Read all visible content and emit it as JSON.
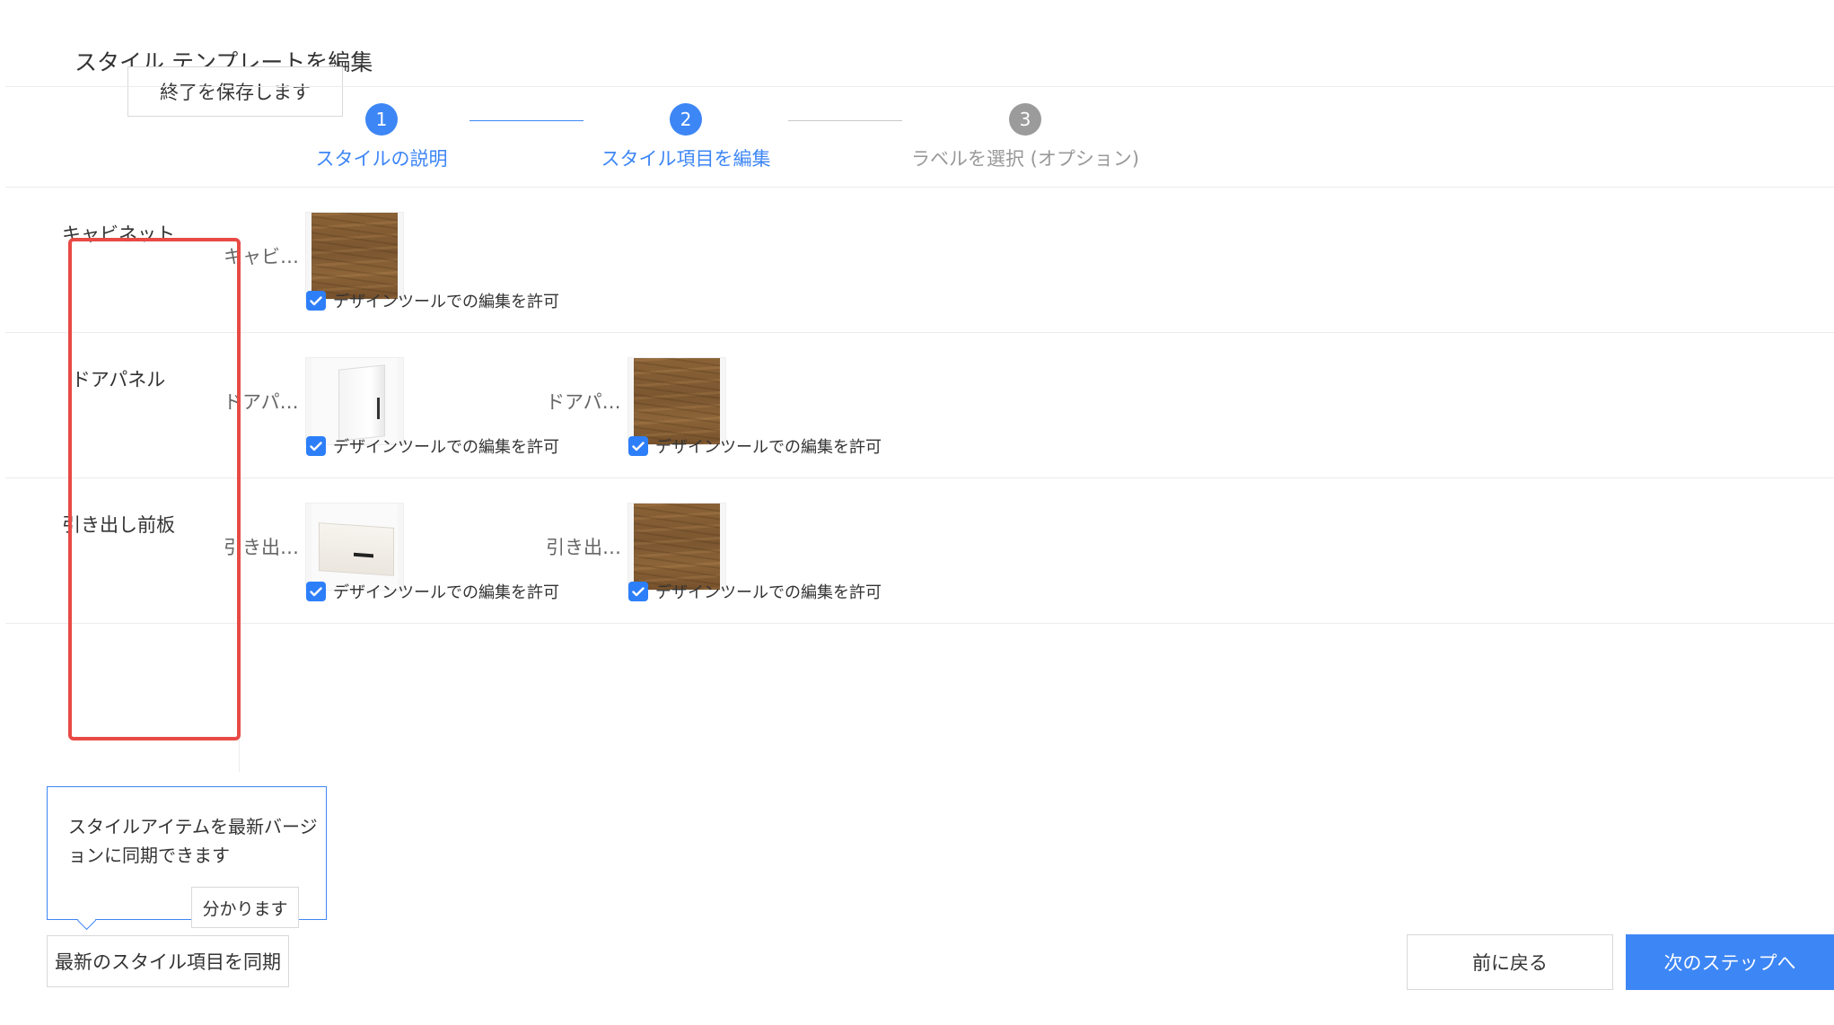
{
  "header": {
    "title": "スタイル テンプレートを編集",
    "save_exit_label": "終了を保存します"
  },
  "steps": [
    {
      "number": "1",
      "label": "スタイルの説明",
      "state": "active"
    },
    {
      "number": "2",
      "label": "スタイル項目を編集",
      "state": "active"
    },
    {
      "number": "3",
      "label": "ラベルを選択 (オプション)",
      "state": "inactive"
    }
  ],
  "rows": [
    {
      "label": "キャビネット",
      "items": [
        {
          "name": "キャビ…",
          "swatch": "wood",
          "allow_edit": "デザインツールでの編集を許可",
          "checked": true
        }
      ]
    },
    {
      "label": "ドアパネル",
      "items": [
        {
          "name": "ドアパ…",
          "swatch": "door",
          "allow_edit": "デザインツールでの編集を許可",
          "checked": true
        },
        {
          "name": "ドアパ…",
          "swatch": "wood",
          "allow_edit": "デザインツールでの編集を許可",
          "checked": true
        }
      ]
    },
    {
      "label": "引き出し前板",
      "items": [
        {
          "name": "引き出…",
          "swatch": "drawer",
          "allow_edit": "デザインツールでの編集を許可",
          "checked": true
        },
        {
          "name": "引き出…",
          "swatch": "wood",
          "allow_edit": "デザインツールでの編集を許可",
          "checked": true
        }
      ]
    }
  ],
  "tooltip": {
    "text": "スタイルアイテムを最新バージョンに同期できます",
    "got_it_label": "分かります"
  },
  "footer": {
    "sync_label": "最新のスタイル項目を同期",
    "prev_label": "前に戻る",
    "next_label": "次のステップへ"
  },
  "colors": {
    "accent": "#3d86f5",
    "highlight": "#e84a45",
    "inactive_step": "#9b9b9b"
  }
}
